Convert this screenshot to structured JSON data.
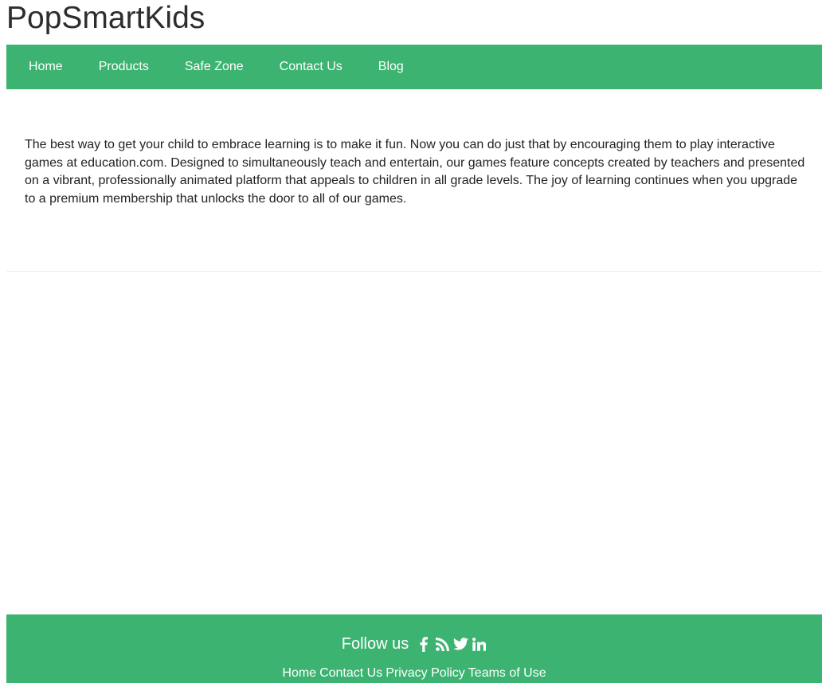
{
  "site": {
    "title": "PopSmartKids"
  },
  "nav": {
    "items": [
      {
        "label": "Home"
      },
      {
        "label": "Products"
      },
      {
        "label": "Safe Zone"
      },
      {
        "label": "Contact Us"
      },
      {
        "label": "Blog"
      }
    ]
  },
  "main": {
    "intro_text": "The best way to get your child to embrace learning is to make it fun. Now you can do just that by encouraging them to play interactive games at education.com. Designed to simultaneously teach and entertain, our games feature concepts created by teachers and presented on a vibrant, professionally animated platform that appeals to children in all grade levels. The joy of learning continues when you upgrade to a premium membership that unlocks the door to all of our games."
  },
  "footer": {
    "follow_label": "Follow us",
    "social_icons": [
      "facebook-icon",
      "rss-icon",
      "twitter-icon",
      "linkedin-icon"
    ],
    "links": [
      {
        "label": "Home"
      },
      {
        "label": "Contact Us"
      },
      {
        "label": "Privacy Policy"
      },
      {
        "label": "Teams of Use"
      }
    ]
  },
  "colors": {
    "brand_green": "#3cb371",
    "text": "#222222",
    "title": "#2d2d2d"
  }
}
